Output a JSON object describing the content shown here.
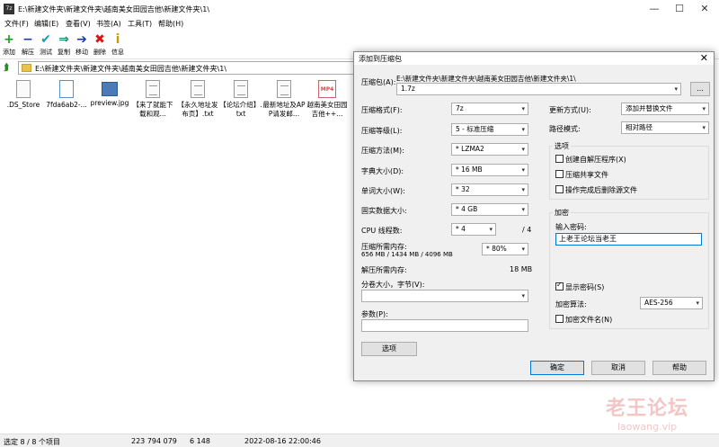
{
  "window": {
    "app_icon": "7z",
    "title": "E:\\新建文件夹\\新建文件夹\\越南美女田园吉他\\新建文件夹\\1\\",
    "min": "—",
    "max": "☐",
    "close": "✕"
  },
  "menu": [
    "文件(F)",
    "编辑(E)",
    "查看(V)",
    "书签(A)",
    "工具(T)",
    "帮助(H)"
  ],
  "toolbar": [
    {
      "label": "添加",
      "icon": "+",
      "color": "#1a9a1a"
    },
    {
      "label": "解压",
      "icon": "−",
      "color": "#1a3aa8"
    },
    {
      "label": "测试",
      "icon": "✔",
      "color": "#1a9ab8"
    },
    {
      "label": "复制",
      "icon": "⇒",
      "color": "#1a8a6a"
    },
    {
      "label": "移动",
      "icon": "➔",
      "color": "#1a3aa8"
    },
    {
      "label": "删除",
      "icon": "✖",
      "color": "#d01818"
    },
    {
      "label": "信息",
      "icon": "i",
      "color": "#c89a10"
    }
  ],
  "address": {
    "path": "E:\\新建文件夹\\新建文件夹\\越南美女田园吉他\\新建文件夹\\1\\"
  },
  "files": [
    {
      "name": ".DS_Store",
      "kind": "blank"
    },
    {
      "name": "7fda6ab2-...",
      "kind": "png"
    },
    {
      "name": "preview.jpg",
      "kind": "img"
    },
    {
      "name": "【来了就能下载和观...",
      "kind": "txt"
    },
    {
      "name": "【永久地址发布页】.txt",
      "kind": "txt"
    },
    {
      "name": "【论坛介绍】.txt",
      "kind": "txt"
    },
    {
      "name": "最新地址及APP请发邮...",
      "kind": "txt"
    },
    {
      "name": "越南美女田园吉他++...",
      "kind": "mp4"
    }
  ],
  "status": {
    "selected": "选定 8 / 8 个项目",
    "size": "223 794 079",
    "packed": "6 148",
    "date": "2022-08-16 22:00:46"
  },
  "watermark": {
    "cn": "老王论坛",
    "url": "laowang.vip"
  },
  "dialog": {
    "title": "添加到压缩包",
    "close": "✕",
    "archive_label": "压缩包(A):",
    "archive_dir": "E:\\新建文件夹\\新建文件夹\\越南美女田园吉他\\新建文件夹\\1\\",
    "archive_name": "1.7z",
    "browse": "...",
    "format_label": "压缩格式(F):",
    "format_value": "7z",
    "level_label": "压缩等级(L):",
    "level_value": "5 - 标准压缩",
    "method_label": "压缩方法(M):",
    "method_value": "* LZMA2",
    "dict_label": "字典大小(D):",
    "dict_value": "* 16 MB",
    "word_label": "单词大小(W):",
    "word_value": "* 32",
    "solid_label": "固实数据大小:",
    "solid_value": "* 4 GB",
    "cpu_label": "CPU 线程数:",
    "cpu_value": "* 4",
    "cpu_total": "/ 4",
    "mem_label": "压缩所需内存:",
    "mem_detail": "656 MB / 1434 MB / 4096 MB",
    "mem_value": "* 80%",
    "decomp_label": "解压所需内存:",
    "decomp_value": "18 MB",
    "volume_label": "分卷大小，字节(V):",
    "params_label": "参数(P):",
    "options_button": "选项",
    "update_label": "更新方式(U):",
    "update_value": "添加并替换文件",
    "path_label": "路径模式:",
    "path_value": "相对路径",
    "options_group": "选项",
    "opt_sfx": "创建自解压程序(X)",
    "opt_shared": "压缩共享文件",
    "opt_delete": "操作完成后删除源文件",
    "encrypt_group": "加密",
    "password_label": "输入密码:",
    "password_value": "上老王论坛当老王",
    "show_password": "显示密码(S)",
    "enc_method_label": "加密算法:",
    "enc_method_value": "AES-256",
    "encrypt_names": "加密文件名(N)",
    "ok": "确定",
    "cancel": "取消",
    "help": "帮助"
  }
}
